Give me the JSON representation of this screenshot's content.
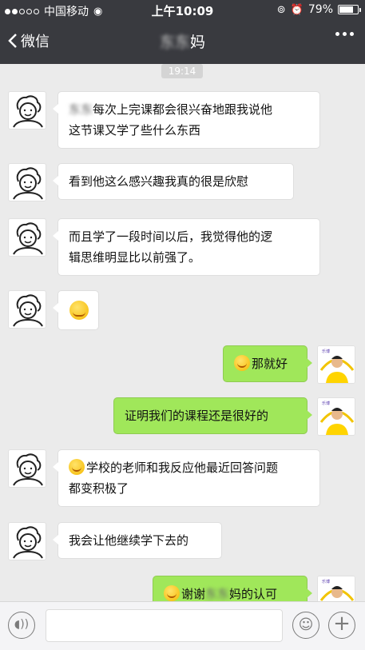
{
  "status_bar": {
    "carrier": "中国移动",
    "time": "上午10:09",
    "battery": "79%",
    "battery_level": 0.79
  },
  "nav": {
    "back_label": "微信",
    "title_blurred": "东东",
    "title_suffix": "妈"
  },
  "chat": {
    "timestamp": "19:14",
    "messages": [
      {
        "side": "in",
        "prefix_blurred": "东东",
        "text": "每次上完课都会很兴奋地跟我说他",
        "text2": "这节课又学了些什么东西"
      },
      {
        "side": "in",
        "text": "看到他这么感兴趣我真的很是欣慰"
      },
      {
        "side": "in",
        "text": "而且学了一段时间以后，我觉得他的逻",
        "text2": "辑思维明显比以前强了。"
      },
      {
        "side": "in",
        "emoji": "smile-emoji"
      },
      {
        "side": "out",
        "emoji": "grin-emoji",
        "text": "那就好"
      },
      {
        "side": "out",
        "text": "证明我们的课程还是很好的"
      },
      {
        "side": "in",
        "emoji": "thinking-emoji",
        "text": "学校的老师和我反应他最近回答问题",
        "text2": "都变积极了"
      },
      {
        "side": "in",
        "text": "我会让他继续学下去的"
      },
      {
        "side": "out",
        "emoji": "laugh-emoji",
        "text": "谢谢",
        "blurred": "东东",
        "text_after": "妈的认可"
      }
    ]
  },
  "input_bar": {
    "placeholder": ""
  },
  "colors": {
    "titlebar": "#393a3f",
    "background": "#ebebeb",
    "outgoing_bubble": "#a0e75a",
    "incoming_bubble": "#ffffff"
  },
  "icons": [
    "wifi-icon",
    "lock-rotation-icon",
    "alarm-icon",
    "battery-icon",
    "chevron-left-icon",
    "more-icon",
    "voice-icon",
    "emoji-icon",
    "plus-icon"
  ]
}
